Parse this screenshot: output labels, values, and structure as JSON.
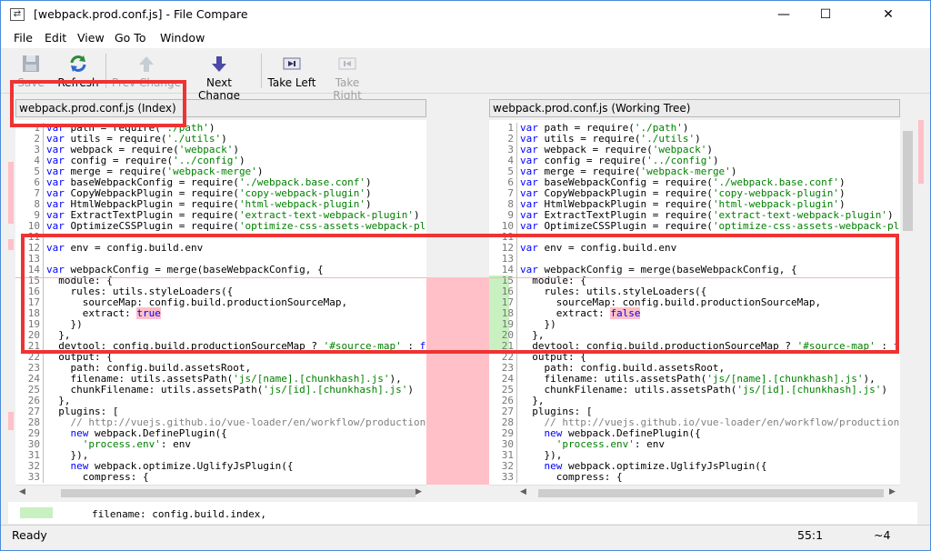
{
  "window": {
    "title": "[webpack.prod.conf.js] - File Compare",
    "minimize": "—",
    "maximize": "☐",
    "close": "✕"
  },
  "menu": [
    "File",
    "Edit",
    "View",
    "Go To",
    "Window"
  ],
  "toolbar": {
    "save": "Save",
    "refresh": "Refresh",
    "prev_change": "Prev Change",
    "next_change": "Next Change",
    "take_left": "Take Left",
    "take_right": "Take Right"
  },
  "left_pane": {
    "header": "webpack.prod.conf.js (Index)"
  },
  "right_pane": {
    "header": "webpack.prod.conf.js (Working Tree)"
  },
  "code_lines": [
    {
      "n": "1",
      "t": "var path = require('./path')"
    },
    {
      "n": "2",
      "t": "var utils = require('./utils')"
    },
    {
      "n": "3",
      "t": "var webpack = require('webpack')"
    },
    {
      "n": "4",
      "t": "var config = require('../config')"
    },
    {
      "n": "5",
      "t": "var merge = require('webpack-merge')"
    },
    {
      "n": "6",
      "t": "var baseWebpackConfig = require('./webpack.base.conf')"
    },
    {
      "n": "7",
      "t": "var CopyWebpackPlugin = require('copy-webpack-plugin')"
    },
    {
      "n": "8",
      "t": "var HtmlWebpackPlugin = require('html-webpack-plugin')"
    },
    {
      "n": "9",
      "t": "var ExtractTextPlugin = require('extract-text-webpack-plugin')"
    },
    {
      "n": "10",
      "t": "var OptimizeCSSPlugin = require('optimize-css-assets-webpack-plugin')"
    },
    {
      "n": "11",
      "t": ""
    },
    {
      "n": "12",
      "t": "var env = config.build.env"
    },
    {
      "n": "13",
      "t": ""
    },
    {
      "n": "14",
      "t": "var webpackConfig = merge(baseWebpackConfig, {"
    },
    {
      "n": "15",
      "t": "  module: {"
    },
    {
      "n": "16",
      "t": "    rules: utils.styleLoaders({"
    },
    {
      "n": "17",
      "t": "      sourceMap: config.build.productionSourceMap,"
    },
    {
      "n": "18",
      "t": "      extract: true"
    },
    {
      "n": "19",
      "t": "    })"
    },
    {
      "n": "20",
      "t": "  },"
    },
    {
      "n": "21",
      "t": "  devtool: config.build.productionSourceMap ? '#source-map' : false,"
    },
    {
      "n": "22",
      "t": "  output: {"
    },
    {
      "n": "23",
      "t": "    path: config.build.assetsRoot,"
    },
    {
      "n": "24",
      "t": "    filename: utils.assetsPath('js/[name].[chunkhash].js'),"
    },
    {
      "n": "25",
      "t": "    chunkFilename: utils.assetsPath('js/[id].[chunkhash].js')"
    },
    {
      "n": "26",
      "t": "  },"
    },
    {
      "n": "27",
      "t": "  plugins: ["
    },
    {
      "n": "28",
      "t": "    // http://vuejs.github.io/vue-loader/en/workflow/production.html"
    },
    {
      "n": "29",
      "t": "    new webpack.DefinePlugin({"
    },
    {
      "n": "30",
      "t": "      'process.env': env"
    },
    {
      "n": "31",
      "t": "    }),"
    },
    {
      "n": "32",
      "t": "    new webpack.optimize.UglifyJsPlugin({"
    },
    {
      "n": "33",
      "t": "      compress: {"
    }
  ],
  "left_line18_value": "true",
  "right_line18_value": "false",
  "bottom_detail": "filename: config.build.index,",
  "status": {
    "ready": "Ready",
    "position": "55:1",
    "indicator": "~4"
  },
  "colors": {
    "changed": "#ffc0c8",
    "added": "#c8f0c0",
    "annotation_box": "#ee3333",
    "keyword": "#0000ff",
    "string": "#008000"
  }
}
